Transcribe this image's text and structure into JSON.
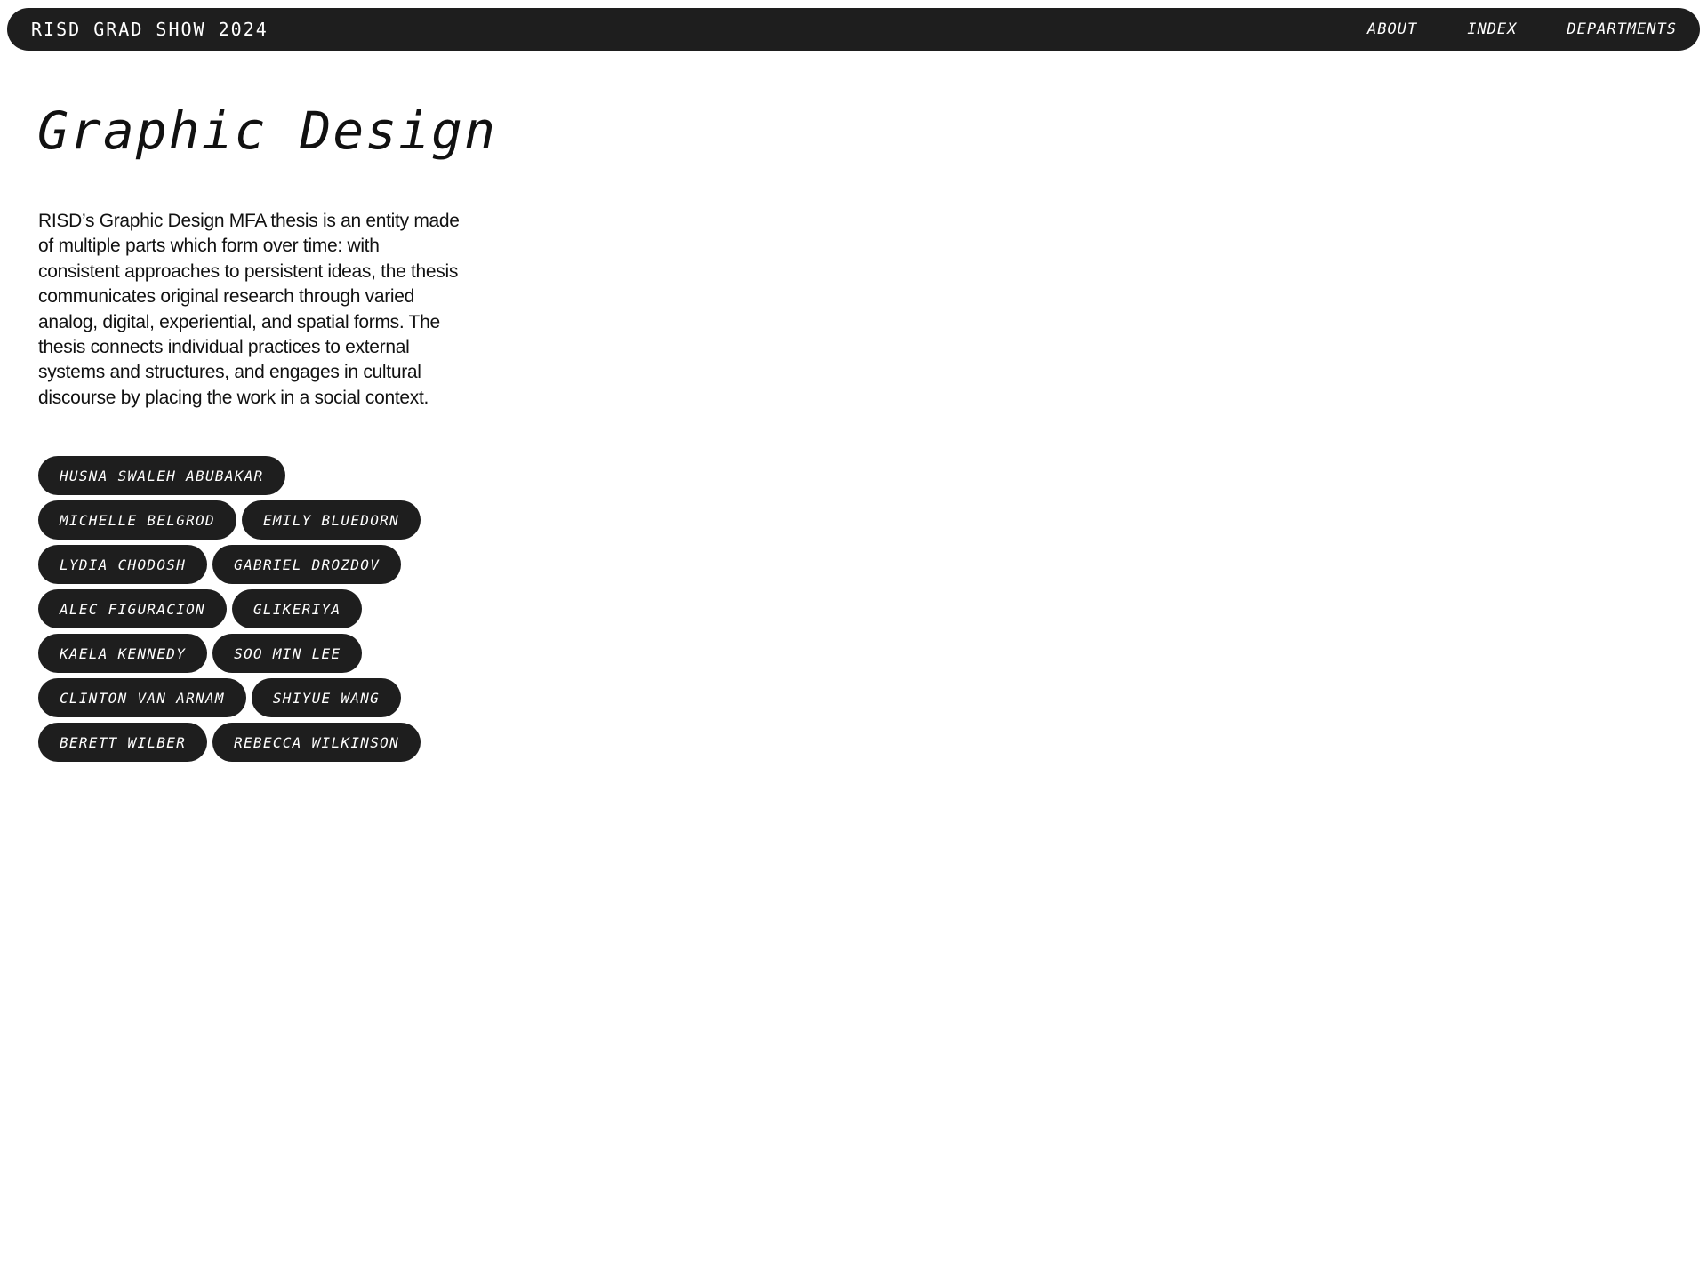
{
  "header": {
    "site_title": "RISD GRAD SHOW 2024",
    "nav": [
      {
        "label": "ABOUT"
      },
      {
        "label": "INDEX"
      },
      {
        "label": "DEPARTMENTS"
      }
    ]
  },
  "main": {
    "title": "Graphic Design",
    "description": "RISD’s Graphic Design MFA thesis is an entity made of multiple parts which form over time: with consistent approaches to persistent ideas, the thesis communicates original research through varied analog, digital, experiential, and spatial forms. The thesis connects individual practices to external systems and structures, and engages in cultural discourse by placing the work in a social context.",
    "students": [
      [
        "HUSNA SWALEH ABUBAKAR"
      ],
      [
        "MICHELLE BELGROD",
        "EMILY BLUEDORN"
      ],
      [
        "LYDIA CHODOSH",
        "GABRIEL DROZDOV"
      ],
      [
        "ALEC FIGURACION",
        "GLIKERIYA"
      ],
      [
        "KAELA KENNEDY",
        "SOO MIN LEE"
      ],
      [
        "CLINTON VAN ARNAM",
        "SHIYUE WANG"
      ],
      [
        "BERETT WILBER",
        "REBECCA WILKINSON"
      ]
    ]
  },
  "colors": {
    "pill_background": "#1e1e1e",
    "pill_text": "#ffffff",
    "page_background": "#ffffff"
  }
}
